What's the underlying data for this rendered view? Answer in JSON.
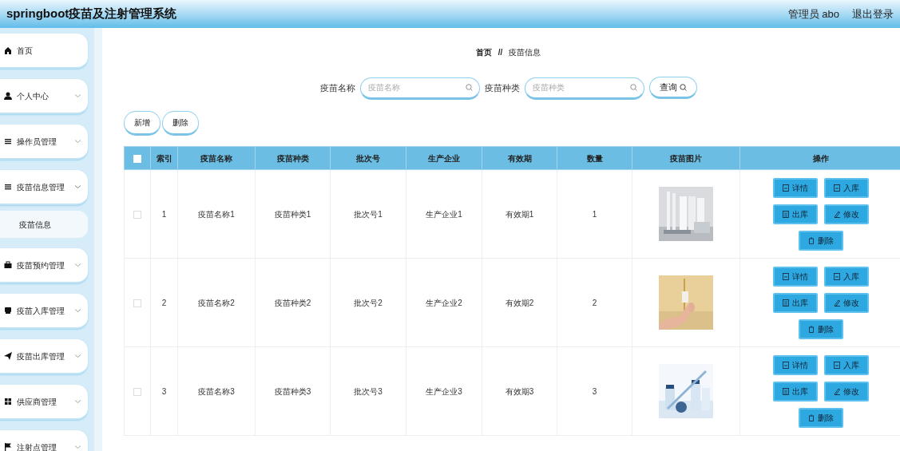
{
  "header": {
    "title": "springboot疫苗及注射管理系统",
    "user": "管理员 abo",
    "logout": "退出登录"
  },
  "sidebar": {
    "items": [
      {
        "label": "首页",
        "expandable": false,
        "expanded": false
      },
      {
        "label": "个人中心",
        "expandable": true,
        "expanded": false
      },
      {
        "label": "操作员管理",
        "expandable": true,
        "expanded": false
      },
      {
        "label": "疫苗信息管理",
        "expandable": true,
        "expanded": true,
        "children": [
          {
            "label": "疫苗信息",
            "selected": true
          }
        ]
      },
      {
        "label": "疫苗预约管理",
        "expandable": true,
        "expanded": false
      },
      {
        "label": "疫苗入库管理",
        "expandable": true,
        "expanded": false
      },
      {
        "label": "疫苗出库管理",
        "expandable": true,
        "expanded": false
      },
      {
        "label": "供应商管理",
        "expandable": true,
        "expanded": false
      },
      {
        "label": "注射点管理",
        "expandable": true,
        "expanded": false
      }
    ]
  },
  "breadcrumb": {
    "items": [
      "首页",
      "疫苗信息"
    ],
    "separator": "//"
  },
  "search": {
    "fields": [
      {
        "label": "疫苗名称",
        "placeholder": "疫苗名称"
      },
      {
        "label": "疫苗种类",
        "placeholder": "疫苗种类"
      }
    ],
    "button": "查询"
  },
  "toolbar": [
    "新增",
    "删除"
  ],
  "table": {
    "select_all_checked": false,
    "columns": [
      "索引",
      "疫苗名称",
      "疫苗种类",
      "批次号",
      "生产企业",
      "有效期",
      "数量",
      "疫苗图片",
      "操作"
    ],
    "rows": [
      {
        "checked": false,
        "cells": [
          "1",
          "疫苗名称1",
          "疫苗种类1",
          "批次号1",
          "生产企业1",
          "有效期1",
          "1"
        ],
        "actions": [
          "详情",
          "入库",
          "出库",
          "修改",
          "删除"
        ]
      },
      {
        "checked": false,
        "cells": [
          "2",
          "疫苗名称2",
          "疫苗种类2",
          "批次号2",
          "生产企业2",
          "有效期2",
          "2"
        ],
        "actions": [
          "详情",
          "入库",
          "出库",
          "修改",
          "删除"
        ]
      },
      {
        "checked": false,
        "cells": [
          "3",
          "疫苗名称3",
          "疫苗种类3",
          "批次号3",
          "生产企业3",
          "有效期3",
          "3"
        ],
        "actions": [
          "详情",
          "入库",
          "出库",
          "修改",
          "删除"
        ]
      }
    ]
  }
}
